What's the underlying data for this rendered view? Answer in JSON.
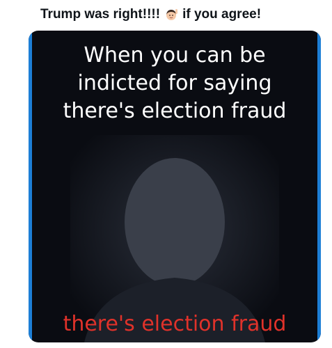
{
  "post": {
    "text_before_emoji": "Trump was right!!!!",
    "emoji": "woman-raising-hand-emoji",
    "text_after_emoji": "if you agree!"
  },
  "meme": {
    "top_lines": [
      "When you can be",
      "indicted for saying",
      "there's election fraud"
    ],
    "bottom_text": "there's election fraud",
    "top_text_color": "#ffffff",
    "bottom_text_color": "#e0322a",
    "background_color": "#0a0c12",
    "border_color": "#1d7fd6"
  }
}
